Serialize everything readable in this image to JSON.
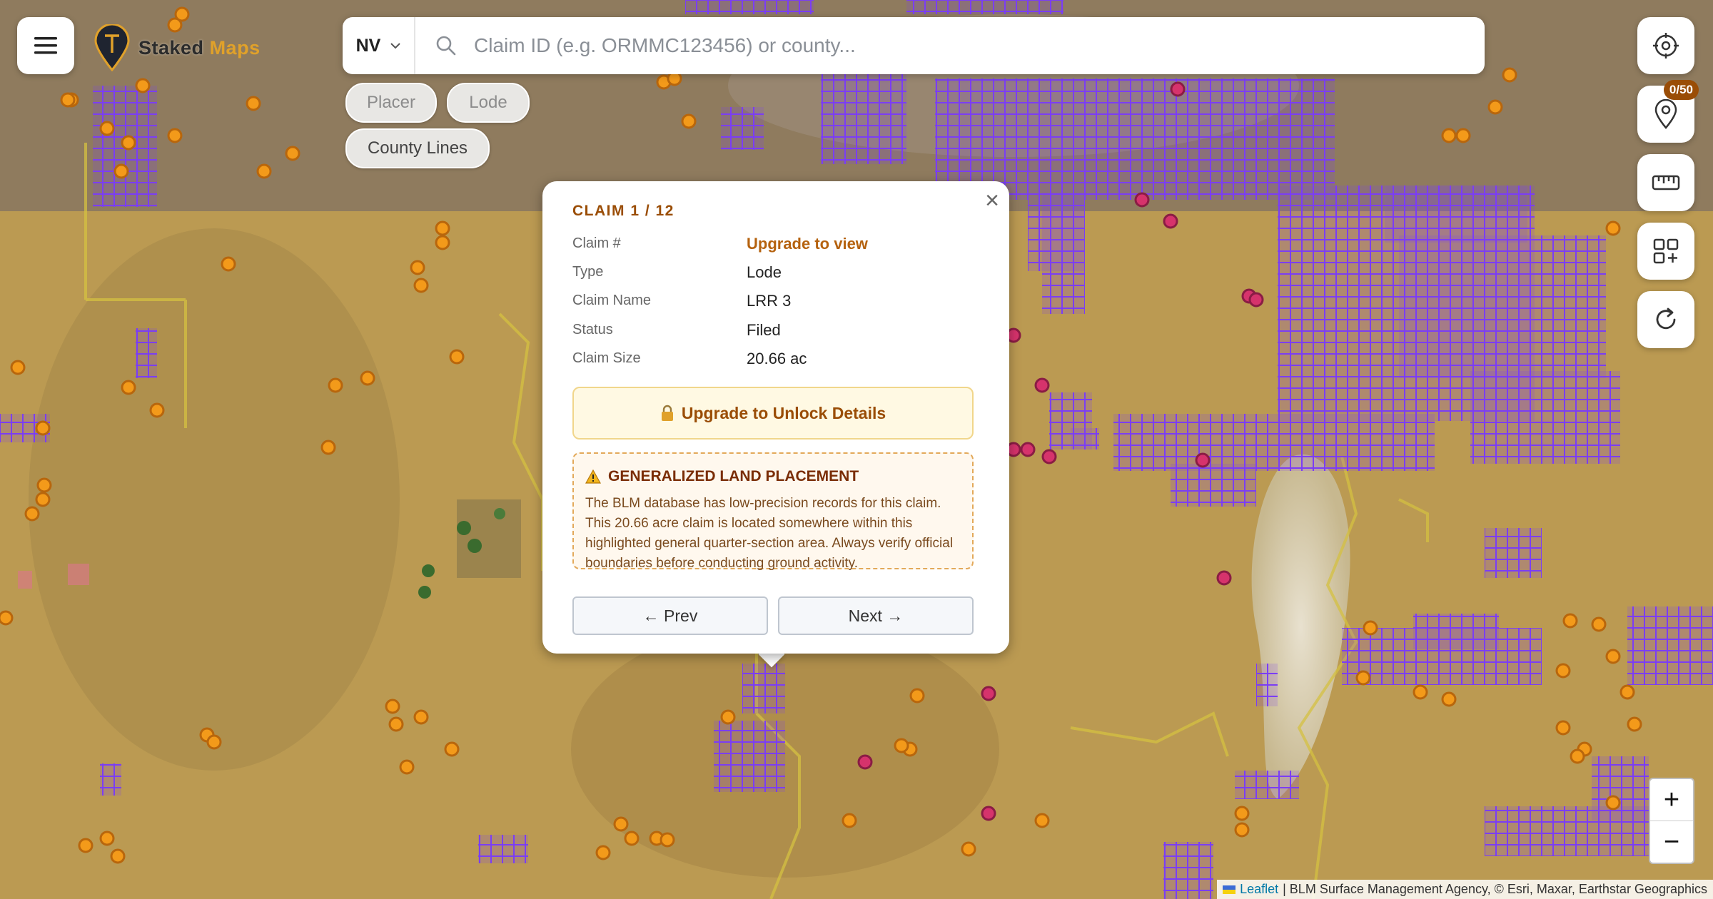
{
  "header": {
    "logo_word1": "Staked",
    "logo_word2": "Maps"
  },
  "search": {
    "state": "NV",
    "placeholder": "Claim ID (e.g. ORMMC123456) or county..."
  },
  "filters": {
    "placer": "Placer",
    "lode": "Lode",
    "county_lines": "County Lines"
  },
  "toolbar": {
    "pins_badge": "0/50",
    "icons": [
      "crosshair-icon",
      "map-pin-icon",
      "ruler-icon",
      "layers-grid-icon",
      "refresh-icon"
    ]
  },
  "zoom": {
    "in": "+",
    "out": "−"
  },
  "attribution": {
    "leaflet": "Leaflet",
    "sources": "| BLM Surface Management Agency, © Esri, Maxar, Earthstar Geographics"
  },
  "popup": {
    "title": "CLAIM 1 / 12",
    "close": "×",
    "rows": [
      {
        "label": "Claim #",
        "value": "Upgrade to view"
      },
      {
        "label": "Type",
        "value": "Lode"
      },
      {
        "label": "Claim Name",
        "value": "LRR 3"
      },
      {
        "label": "Status",
        "value": "Filed"
      },
      {
        "label": "Claim Size",
        "value": "20.66 ac"
      }
    ],
    "unlock_label": "Upgrade to Unlock Details",
    "warning_title": "GENERALIZED LAND PLACEMENT",
    "warning_body": "The BLM database has low-precision records for this claim. This 20.66 acre claim is located somewhere within this highlighted general quarter-section area. Always verify official boundaries before conducting ground activity.",
    "prev": "← Prev",
    "next": "Next →"
  },
  "colors": {
    "claim_outline": "#7b3df5",
    "placer_marker": "#f39a1a",
    "lode_marker": "#d6336c",
    "accent": "#9a4d06"
  }
}
